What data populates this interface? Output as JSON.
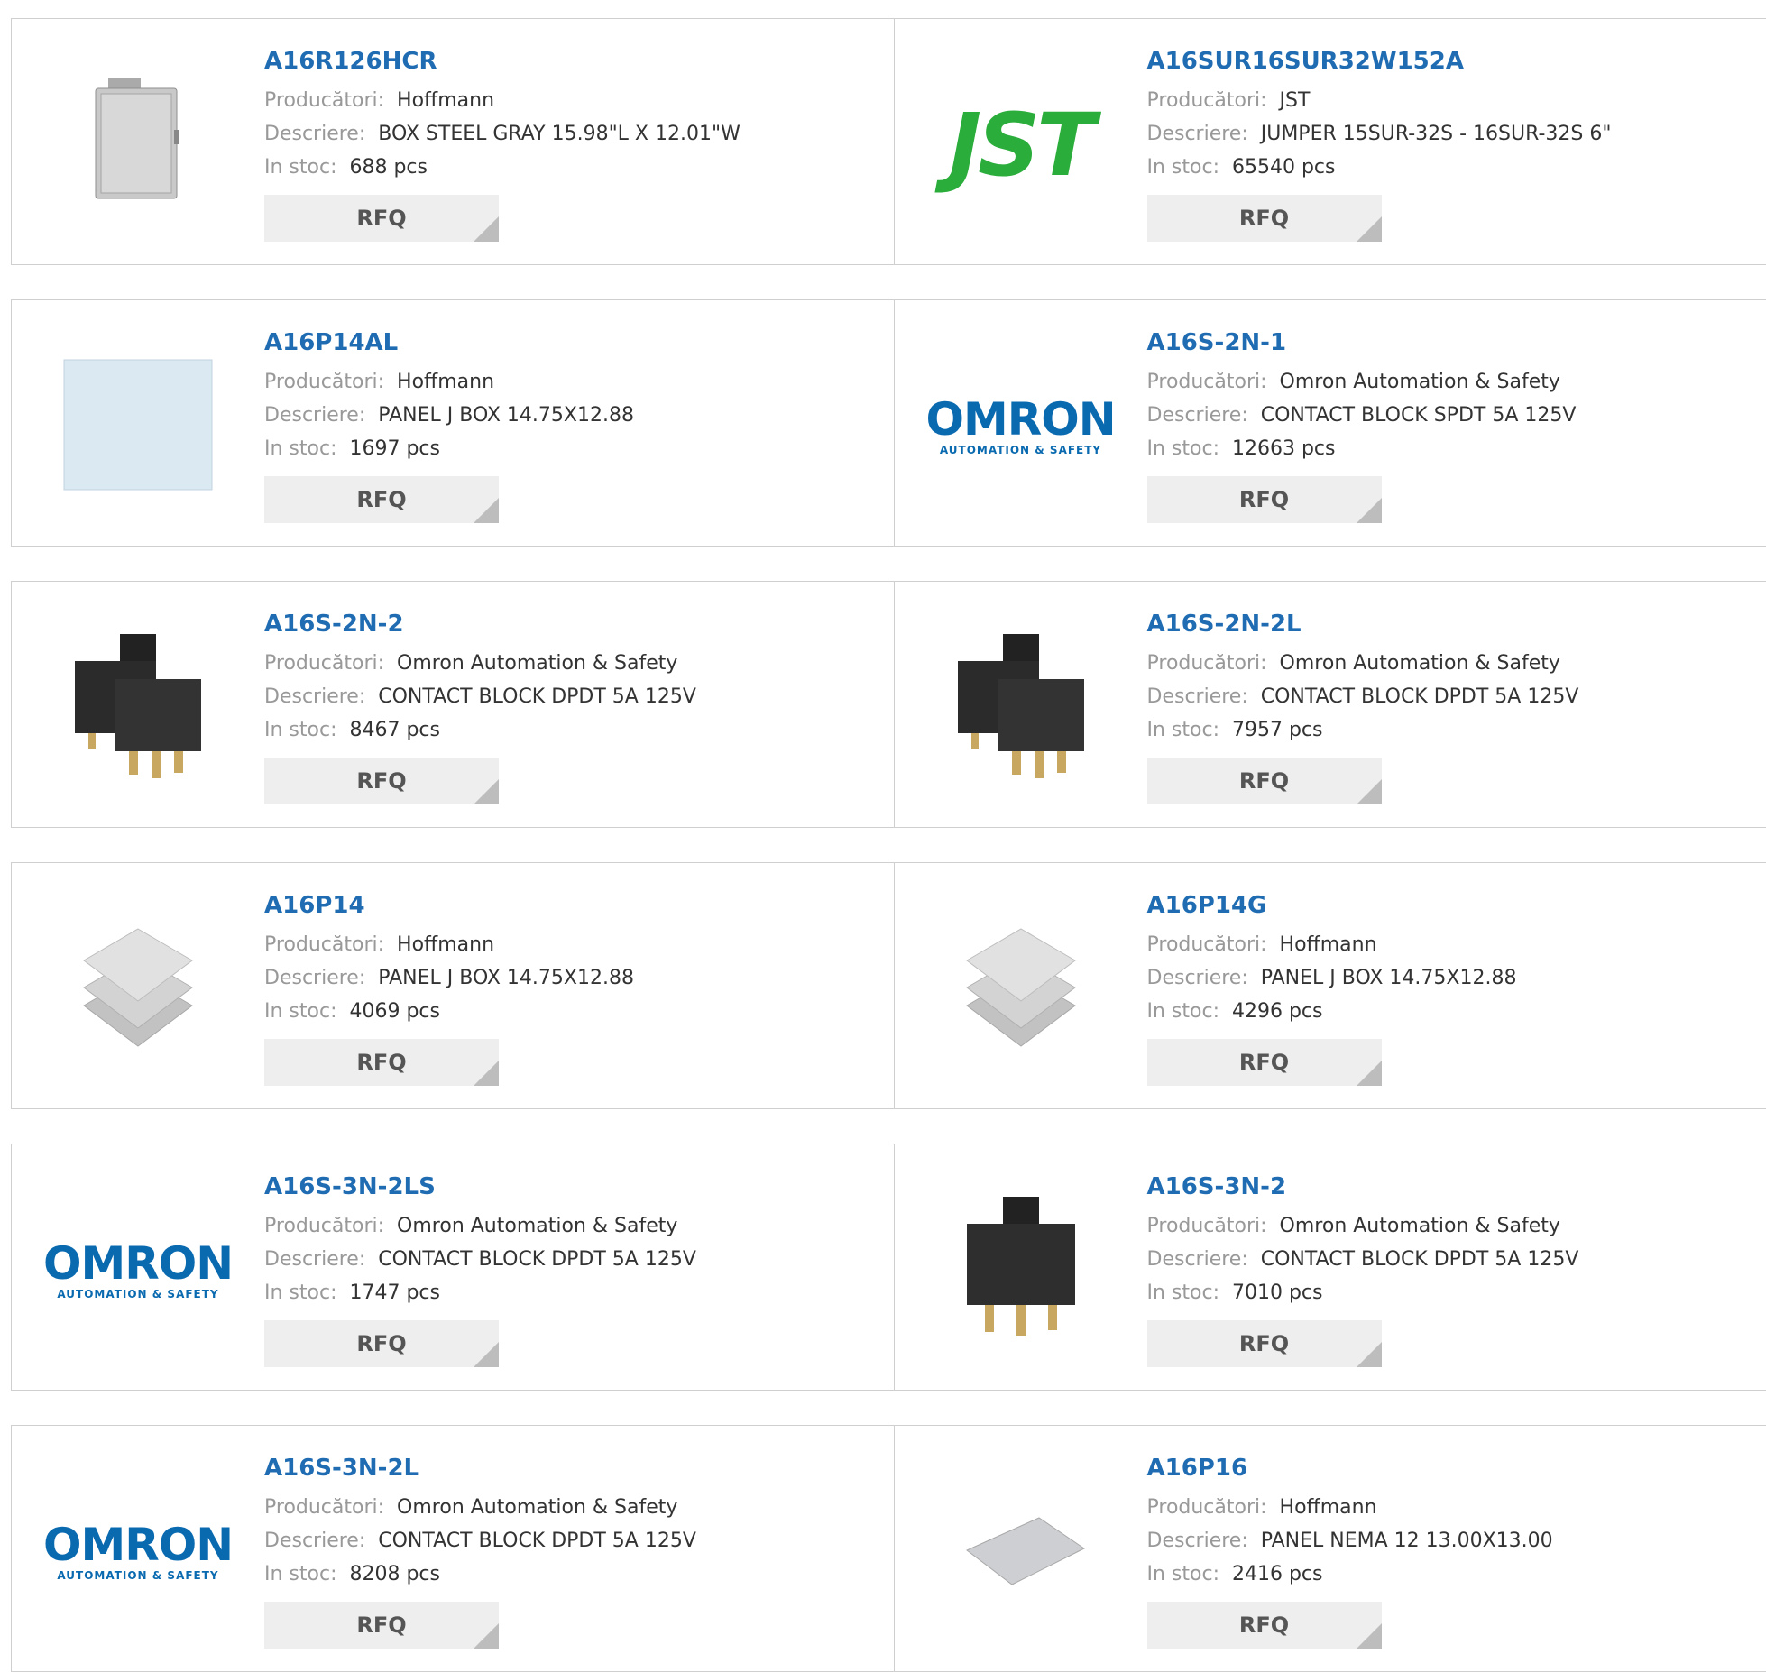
{
  "labels": {
    "manufacturer": "Producători:",
    "description": "Descriere:",
    "stock": "In stoc:",
    "rfq": "RFQ"
  },
  "products": [
    {
      "pn": "A16R126HCR",
      "mfr": "Hoffmann",
      "desc": "BOX STEEL GRAY 15.98\"L X 12.01\"W",
      "stock": "688 pcs",
      "image": "steel-box-image"
    },
    {
      "pn": "A16SUR16SUR32W152A",
      "mfr": "JST",
      "desc": "JUMPER 15SUR-32S - 16SUR-32S 6\"",
      "stock": "65540 pcs",
      "image": "jst-logo"
    },
    {
      "pn": "A16P14AL",
      "mfr": "Hoffmann",
      "desc": "PANEL J BOX 14.75X12.88",
      "stock": "1697 pcs",
      "image": "panel-image"
    },
    {
      "pn": "A16S-2N-1",
      "mfr": "Omron Automation & Safety",
      "desc": "CONTACT BLOCK SPDT 5A 125V",
      "stock": "12663 pcs",
      "image": "omron-logo"
    },
    {
      "pn": "A16S-2N-2",
      "mfr": "Omron Automation & Safety",
      "desc": "CONTACT BLOCK DPDT 5A 125V",
      "stock": "8467 pcs",
      "image": "contact-block-image"
    },
    {
      "pn": "A16S-2N-2L",
      "mfr": "Omron Automation & Safety",
      "desc": "CONTACT BLOCK DPDT 5A 125V",
      "stock": "7957 pcs",
      "image": "contact-block-image"
    },
    {
      "pn": "A16P14",
      "mfr": "Hoffmann",
      "desc": "PANEL J BOX 14.75X12.88",
      "stock": "4069 pcs",
      "image": "stacked-panels-image"
    },
    {
      "pn": "A16P14G",
      "mfr": "Hoffmann",
      "desc": "PANEL J BOX 14.75X12.88",
      "stock": "4296 pcs",
      "image": "stacked-panels-image"
    },
    {
      "pn": "A16S-3N-2LS",
      "mfr": "Omron Automation & Safety",
      "desc": "CONTACT BLOCK DPDT 5A 125V",
      "stock": "1747 pcs",
      "image": "omron-logo"
    },
    {
      "pn": "A16S-3N-2",
      "mfr": "Omron Automation & Safety",
      "desc": "CONTACT BLOCK DPDT 5A 125V",
      "stock": "7010 pcs",
      "image": "contact-block-single-image"
    },
    {
      "pn": "A16S-3N-2L",
      "mfr": "Omron Automation & Safety",
      "desc": "CONTACT BLOCK DPDT 5A 125V",
      "stock": "8208 pcs",
      "image": "omron-logo"
    },
    {
      "pn": "A16P16",
      "mfr": "Hoffmann",
      "desc": "PANEL NEMA 12 13.00X13.00",
      "stock": "2416 pcs",
      "image": "flat-panel-image"
    }
  ],
  "logos": {
    "omron_word": "OMRON",
    "omron_sub": "AUTOMATION & SAFETY",
    "jst_word": "JST"
  }
}
